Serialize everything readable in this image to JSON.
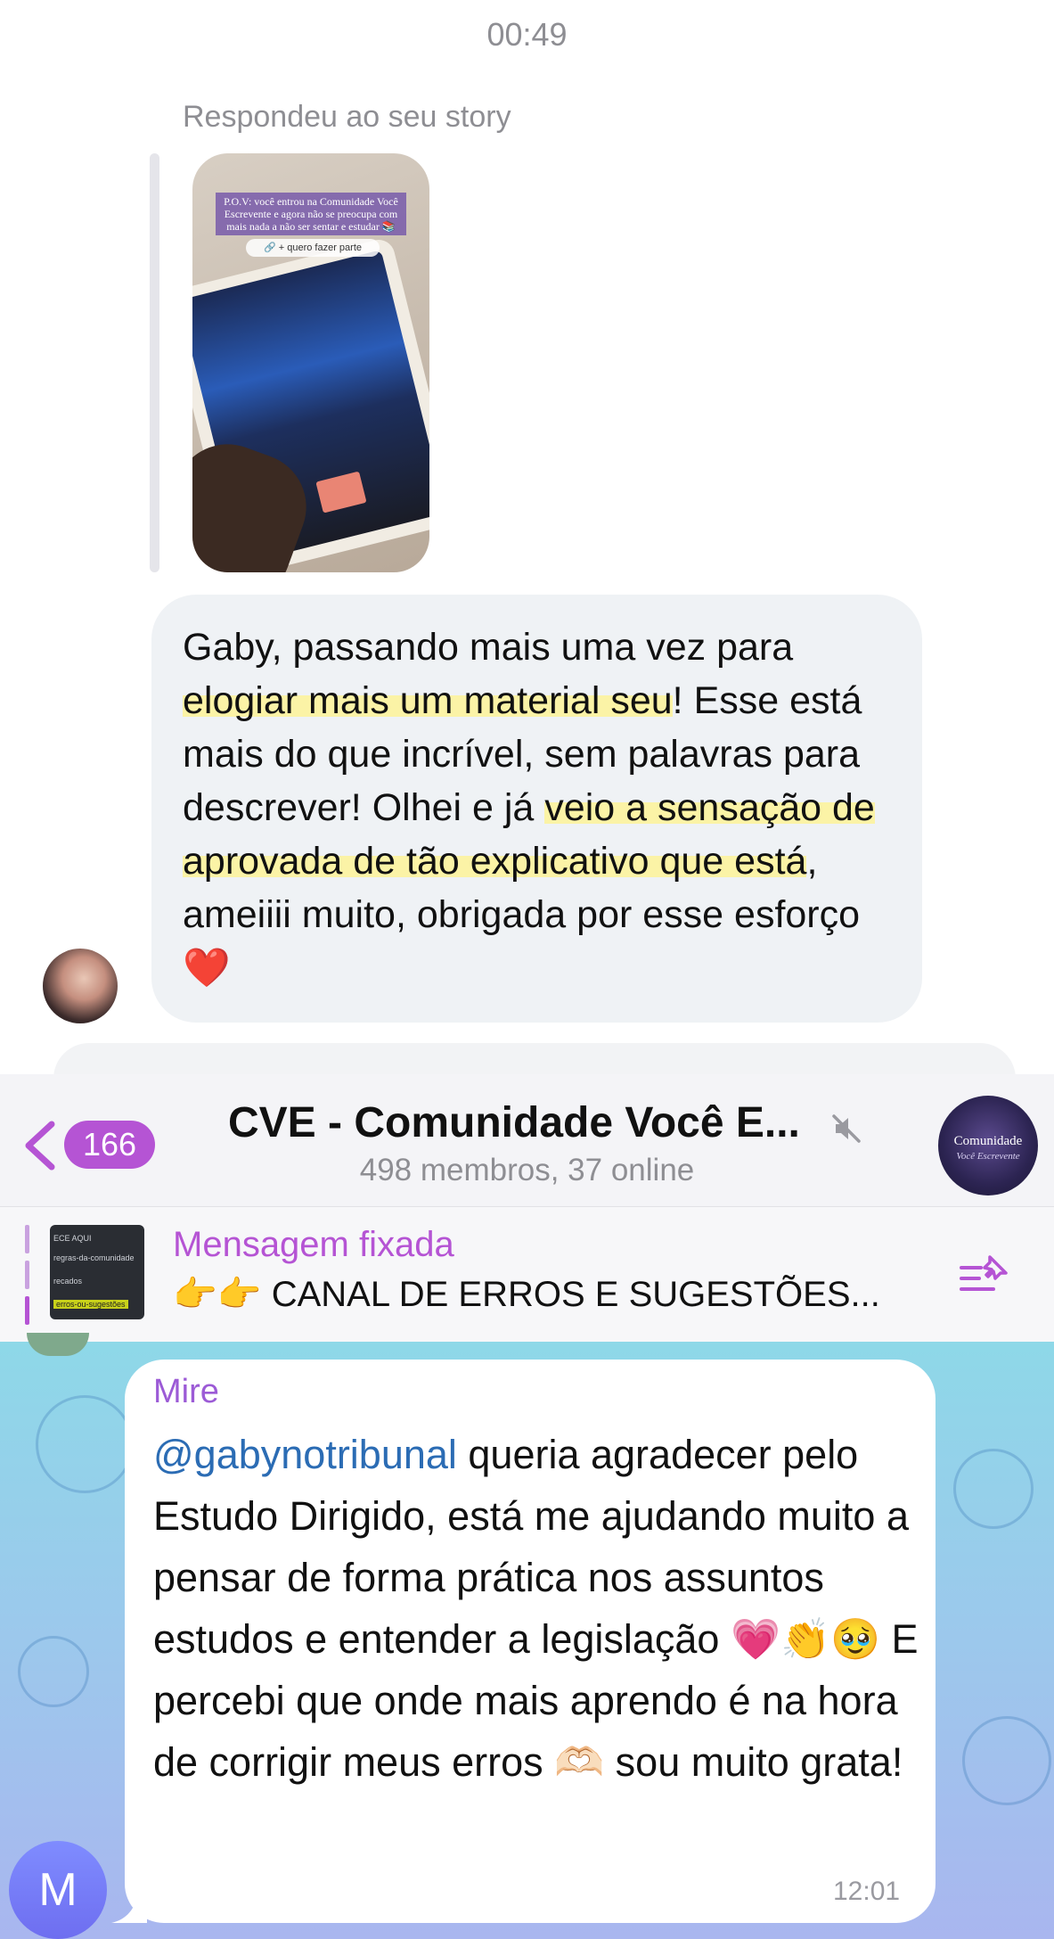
{
  "instagram": {
    "time": "00:49",
    "replied_label": "Respondeu ao seu story",
    "story": {
      "caption": "P.O.V: você entrou na Comunidade Você Escrevente e agora não se preocupa com mais nada a não ser sentar e estudar 📚",
      "sticker": "🔗 + quero fazer parte"
    },
    "message_parts": [
      "Gaby, passando mais uma vez para ",
      "elogiar mais um material seu",
      "! Esse está mais do que incrível, sem palavras para descrever! Olhei e já ",
      "veio a sensação de aprovada de tão explicativo que está",
      ", ameiiii muito, obrigada por esse esforço ",
      "❤️"
    ]
  },
  "telegram": {
    "back_count": "166",
    "chat_title": "CVE - Comunidade Você E...",
    "subtitle": "498 membros, 37 online",
    "group_avatar": {
      "line1": "Comunidade",
      "line2": "Você Escrevente"
    },
    "pinned": {
      "label": "Mensagem fixada",
      "text": "👉👉 CANAL DE ERROS E SUGESTÕES...",
      "thumb_lines": [
        "ECE AQUI",
        "regras-da-comunidade",
        "recados",
        "erros-ou-sugestões"
      ]
    },
    "message": {
      "sender": "Mire",
      "mention": "@gabynotribunal",
      "text": " queria agradecer pelo Estudo Dirigido, está me ajudando muito a pensar de forma prática nos assuntos estudos e entender a legislação 💗👏🥹 E percebi que onde mais aprendo é na hora de corrigir meus erros 🫶🏻 sou muito grata!",
      "time": "12:01"
    },
    "user_avatar_letter": "M",
    "colors": {
      "accent": "#b554d4",
      "mention": "#2b6cb4",
      "sender": "#9c5bd6",
      "avatar": "#7479f5"
    }
  }
}
